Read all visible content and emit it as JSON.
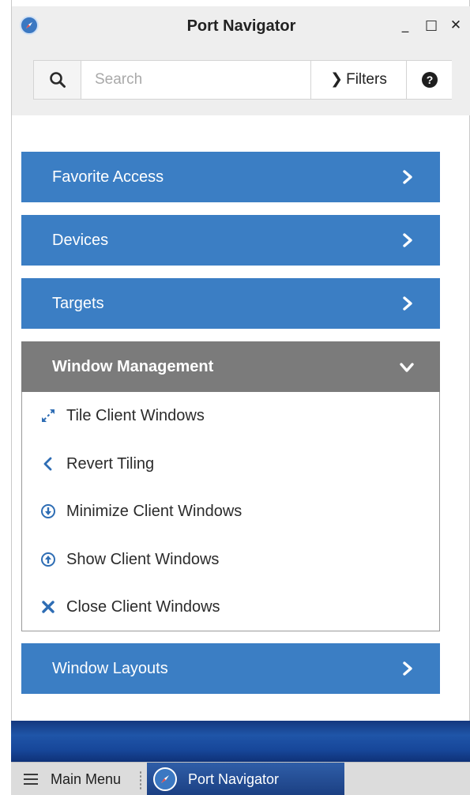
{
  "window": {
    "title": "Port Navigator",
    "controls": {
      "minimize": "_",
      "maximize": "□",
      "close": "✕"
    }
  },
  "search": {
    "placeholder": "Search",
    "value": "",
    "filters_label": "Filters",
    "help_glyph": "?"
  },
  "accordion": {
    "sections": [
      {
        "label": "Favorite Access",
        "expanded": false
      },
      {
        "label": "Devices",
        "expanded": false
      },
      {
        "label": "Targets",
        "expanded": false
      },
      {
        "label": "Window Management",
        "expanded": true
      },
      {
        "label": "Window Layouts",
        "expanded": false
      }
    ],
    "window_management_items": [
      {
        "label": "Tile Client Windows",
        "icon": "expand-arrows-icon"
      },
      {
        "label": "Revert Tiling",
        "icon": "chevron-left-icon"
      },
      {
        "label": "Minimize Client Windows",
        "icon": "circle-arrow-down-icon"
      },
      {
        "label": "Show Client Windows",
        "icon": "circle-arrow-up-icon"
      },
      {
        "label": "Close Client Windows",
        "icon": "close-x-icon"
      }
    ]
  },
  "taskbar": {
    "main_menu_label": "Main Menu",
    "task_label": "Port Navigator"
  },
  "colors": {
    "panel_blue": "#3b7ec4",
    "panel_open_gray": "#7b7b7b",
    "icon_blue": "#2e6db4",
    "titlebar_gray": "#eeeeee",
    "taskbar_gray": "#dcdcdc",
    "task_item_blue": "#2f5ea8"
  }
}
